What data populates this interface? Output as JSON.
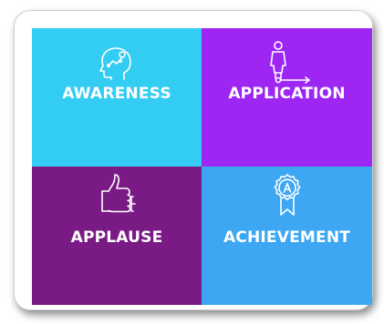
{
  "tiles": [
    {
      "label": "AWARENESS",
      "color": "#33ccf2",
      "icon": "head-idea-icon"
    },
    {
      "label": "APPLICATION",
      "color": "#9d26f3",
      "icon": "person-arrow-icon"
    },
    {
      "label": "APPLAUSE",
      "color": "#7a1a85",
      "icon": "thumbs-up-icon"
    },
    {
      "label": "ACHIEVEMENT",
      "color": "#3da7f3",
      "icon": "award-ribbon-icon"
    }
  ]
}
